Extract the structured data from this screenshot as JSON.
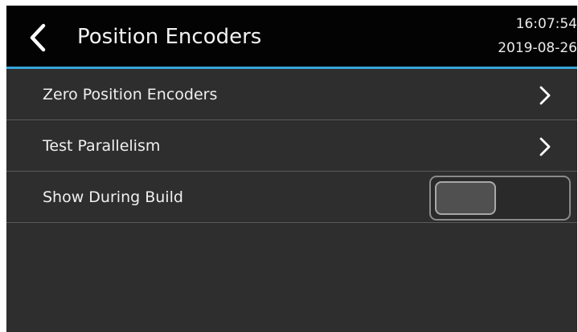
{
  "header": {
    "title": "Position Encoders",
    "back_icon": "chevron-left-icon",
    "clock": {
      "time": "16:07:54",
      "date": "2019-08-26"
    }
  },
  "menu": {
    "items": [
      {
        "label": "Zero Position Encoders",
        "icon": "chevron-right-icon"
      },
      {
        "label": "Test Parallelism",
        "icon": "chevron-right-icon"
      },
      {
        "label": "Show During Build",
        "toggle_on": false
      }
    ]
  },
  "colors": {
    "header_background": "#030303",
    "accent": "#37a6d8",
    "body_background": "#2e2e2e",
    "text": "#f0f0f0"
  }
}
